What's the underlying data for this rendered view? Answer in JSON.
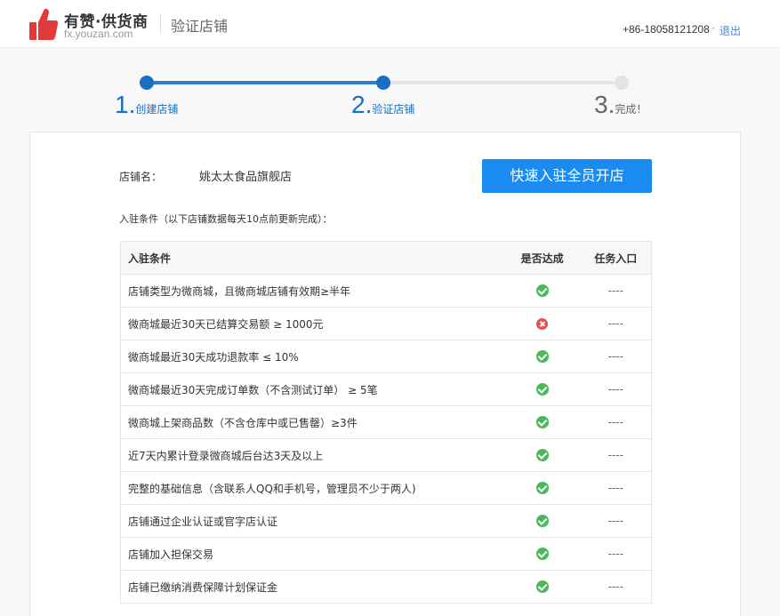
{
  "header": {
    "brand": "有赞·供货商",
    "brand_url": "fx.youzan.com",
    "page_title": "验证店铺",
    "phone": "+86-18058121208",
    "separator": "·",
    "logout": "退出"
  },
  "colors": {
    "accent": "#1a8bf0",
    "progress": "#1a6fc4",
    "ok": "#4cb85c",
    "fail": "#e05555",
    "logo": "#e23a3a"
  },
  "steps": [
    {
      "num": "1.",
      "label": "创建店铺",
      "state": "done"
    },
    {
      "num": "2.",
      "label": "验证店铺",
      "state": "current"
    },
    {
      "num": "3.",
      "label": "完成！",
      "state": "todo"
    }
  ],
  "shop": {
    "label": "店铺名：",
    "name": "姚太太食品旗舰店"
  },
  "cta_label": "快速入驻全员开店",
  "conditions_note": "入驻条件（以下店铺数据每天10点前更新完成）：",
  "table": {
    "headers": [
      "入驻条件",
      "是否达成",
      "任务入口"
    ],
    "rows": [
      {
        "condition": "店铺类型为微商城，且微商城店铺有效期≥半年",
        "met": true,
        "task": "----"
      },
      {
        "condition": "微商城最近30天已结算交易额 ≥ 1000元",
        "met": false,
        "task": "----"
      },
      {
        "condition": "微商城最近30天成功退款率 ≤ 10%",
        "met": true,
        "task": "----"
      },
      {
        "condition": "微商城最近30天完成订单数（不含测试订单） ≥ 5笔",
        "met": true,
        "task": "----"
      },
      {
        "condition": "微商城上架商品数（不含仓库中或已售罄）≥3件",
        "met": true,
        "task": "----"
      },
      {
        "condition": "近7天内累计登录微商城后台达3天及以上",
        "met": true,
        "task": "----"
      },
      {
        "condition": "完整的基础信息（含联系人QQ和手机号，管理员不少于两人)",
        "met": true,
        "task": "----"
      },
      {
        "condition": "店铺通过企业认证或官字店认证",
        "met": true,
        "task": "----"
      },
      {
        "condition": "店铺加入担保交易",
        "met": true,
        "task": "----"
      },
      {
        "condition": "店铺已缴纳消费保障计划保证金",
        "met": true,
        "task": "----"
      }
    ]
  }
}
